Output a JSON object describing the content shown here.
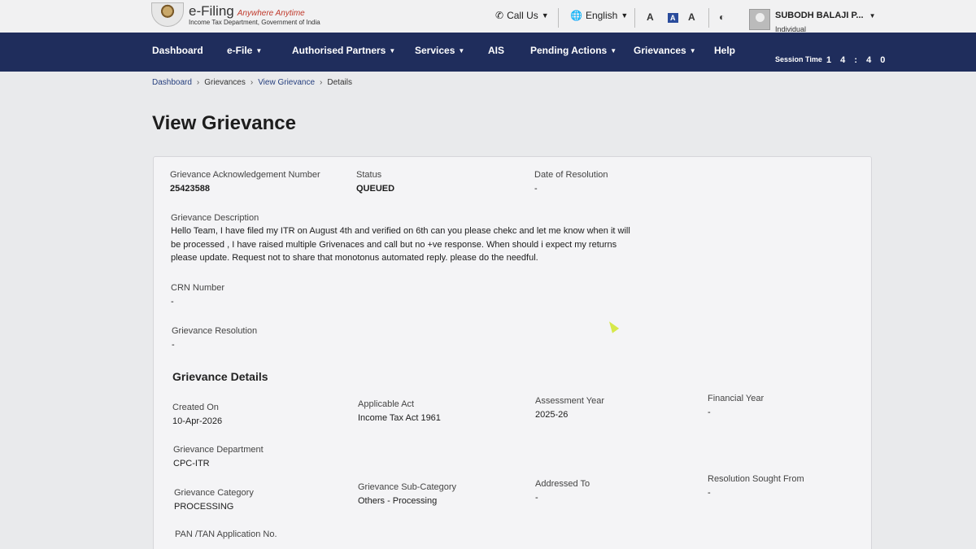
{
  "header": {
    "logo_title": "e-Filing",
    "logo_tagline": "Anywhere Anytime",
    "logo_sub": "Income Tax Department, Government of India",
    "call_us": "Call Us",
    "language": "English",
    "font_decrease": "A",
    "font_normal": "A",
    "font_increase": "A",
    "user_name": "SUBODH BALAJI P...",
    "user_type": "Individual"
  },
  "nav": {
    "items": [
      "Dashboard",
      "e-File",
      "Authorised Partners",
      "Services",
      "AIS",
      "Pending Actions",
      "Grievances",
      "Help"
    ],
    "session_label": "Session Time",
    "session_time": "1 4 : 4 0"
  },
  "breadcrumb": [
    "Dashboard",
    "Grievances",
    "View Grievance",
    "Details"
  ],
  "page_title": "View Grievance",
  "grievance": {
    "ack_label": "Grievance Acknowledgement Number",
    "ack_value": "25423588",
    "status_label": "Status",
    "status_value": "QUEUED",
    "resolution_date_label": "Date of Resolution",
    "resolution_date_value": "-",
    "description_label": "Grievance Description",
    "description_value": "Hello Team, I have filed my ITR on August 4th and verified on 6th can you please chekc and let me know when it will be processed , I have raised multiple Grivenaces and call but no +ve response. When should i expect my returns please update. Request not to share that monotonus automated reply. please do the needful.",
    "crn_label": "CRN Number",
    "crn_value": "-",
    "resolution_label": "Grievance Resolution",
    "resolution_value": "-"
  },
  "details": {
    "heading": "Grievance Details",
    "created_on_label": "Created On",
    "created_on_value": "10-Apr-2026",
    "act_label": "Applicable Act",
    "act_value": "Income Tax Act 1961",
    "ay_label": "Assessment Year",
    "ay_value": "2025-26",
    "fy_label": "Financial Year",
    "fy_value": "-",
    "dept_label": "Grievance Department",
    "dept_value": "CPC-ITR",
    "category_label": "Grievance Category",
    "category_value": "PROCESSING",
    "subcategory_label": "Grievance Sub-Category",
    "subcategory_value": "Others - Processing",
    "addressed_label": "Addressed To",
    "addressed_value": "-",
    "sought_label": "Resolution Sought From",
    "sought_value": "-",
    "pan_label": "PAN /TAN Application No."
  },
  "colors": {
    "nav_bg": "#1f2d5c",
    "link": "#27407f",
    "page_bg": "#e9eaec"
  }
}
